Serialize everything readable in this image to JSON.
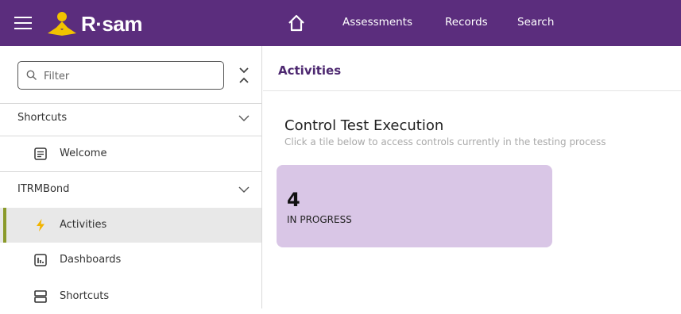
{
  "header": {
    "logo_text": "R·sam",
    "nav": [
      "Assessments",
      "Records",
      "Search"
    ],
    "colors": {
      "bar": "#5b2d7d",
      "logo_accent": "#f2c200"
    },
    "icons": [
      "menu-icon",
      "home-icon"
    ]
  },
  "sidebar": {
    "filter_placeholder": "Filter",
    "sections": [
      {
        "label": "Shortcuts",
        "expanded": true,
        "items": [
          {
            "label": "Welcome",
            "icon": "document-icon"
          }
        ]
      },
      {
        "label": "ITRMBond",
        "expanded": true,
        "items": [
          {
            "label": "Activities",
            "icon": "lightning-icon",
            "active": true
          },
          {
            "label": "Dashboards",
            "icon": "dashboard-icon"
          },
          {
            "label": "Shortcuts",
            "icon": "shortcuts-icon"
          }
        ]
      }
    ],
    "active_accent": "#8a9a2a"
  },
  "main": {
    "page_title": "Activities",
    "section_title": "Control Test Execution",
    "section_subtitle": "Click a tile below to access controls currently in the testing process",
    "tiles": [
      {
        "count": "4",
        "label": "IN PROGRESS",
        "color": "#d9c6e6"
      }
    ]
  }
}
